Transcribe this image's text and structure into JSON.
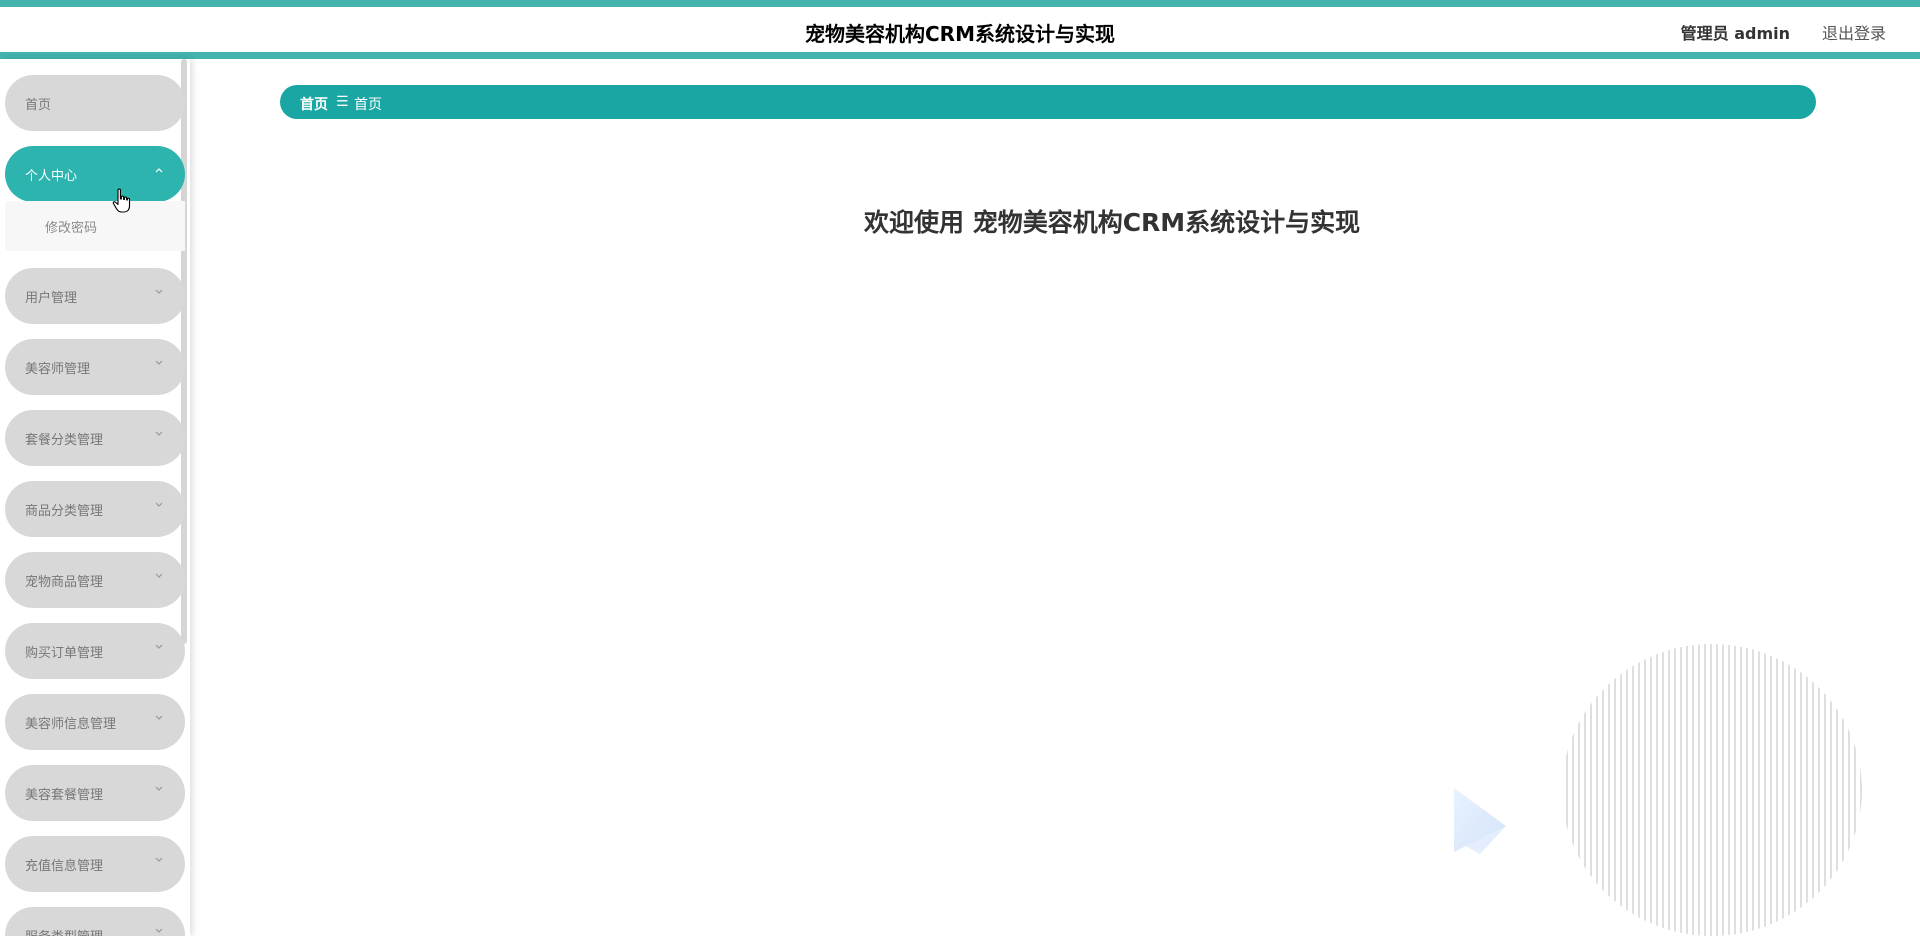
{
  "header": {
    "title": "宠物美容机构CRM系统设计与实现",
    "user": "管理员 admin",
    "logout": "退出登录"
  },
  "sidebar": {
    "items": [
      {
        "label": "首页"
      },
      {
        "label": "个人中心",
        "active": true
      },
      {
        "label": "用户管理"
      },
      {
        "label": "美容师管理"
      },
      {
        "label": "套餐分类管理"
      },
      {
        "label": "商品分类管理"
      },
      {
        "label": "宠物商品管理"
      },
      {
        "label": "购买订单管理"
      },
      {
        "label": "美容师信息管理"
      },
      {
        "label": "美容套餐管理"
      },
      {
        "label": "充值信息管理"
      },
      {
        "label": "服务类型管理"
      }
    ],
    "submenu": {
      "label": "修改密码"
    }
  },
  "breadcrumb": {
    "home": "首页",
    "separator": "☰",
    "current": "首页"
  },
  "main": {
    "welcome": "欢迎使用 宠物美容机构CRM系统设计与实现"
  },
  "colors": {
    "accent": "#44b3ad",
    "breadcrumb": "#1aa6a3",
    "menu_active": "#2eb4ae",
    "menu_idle": "#d8d8d8"
  }
}
